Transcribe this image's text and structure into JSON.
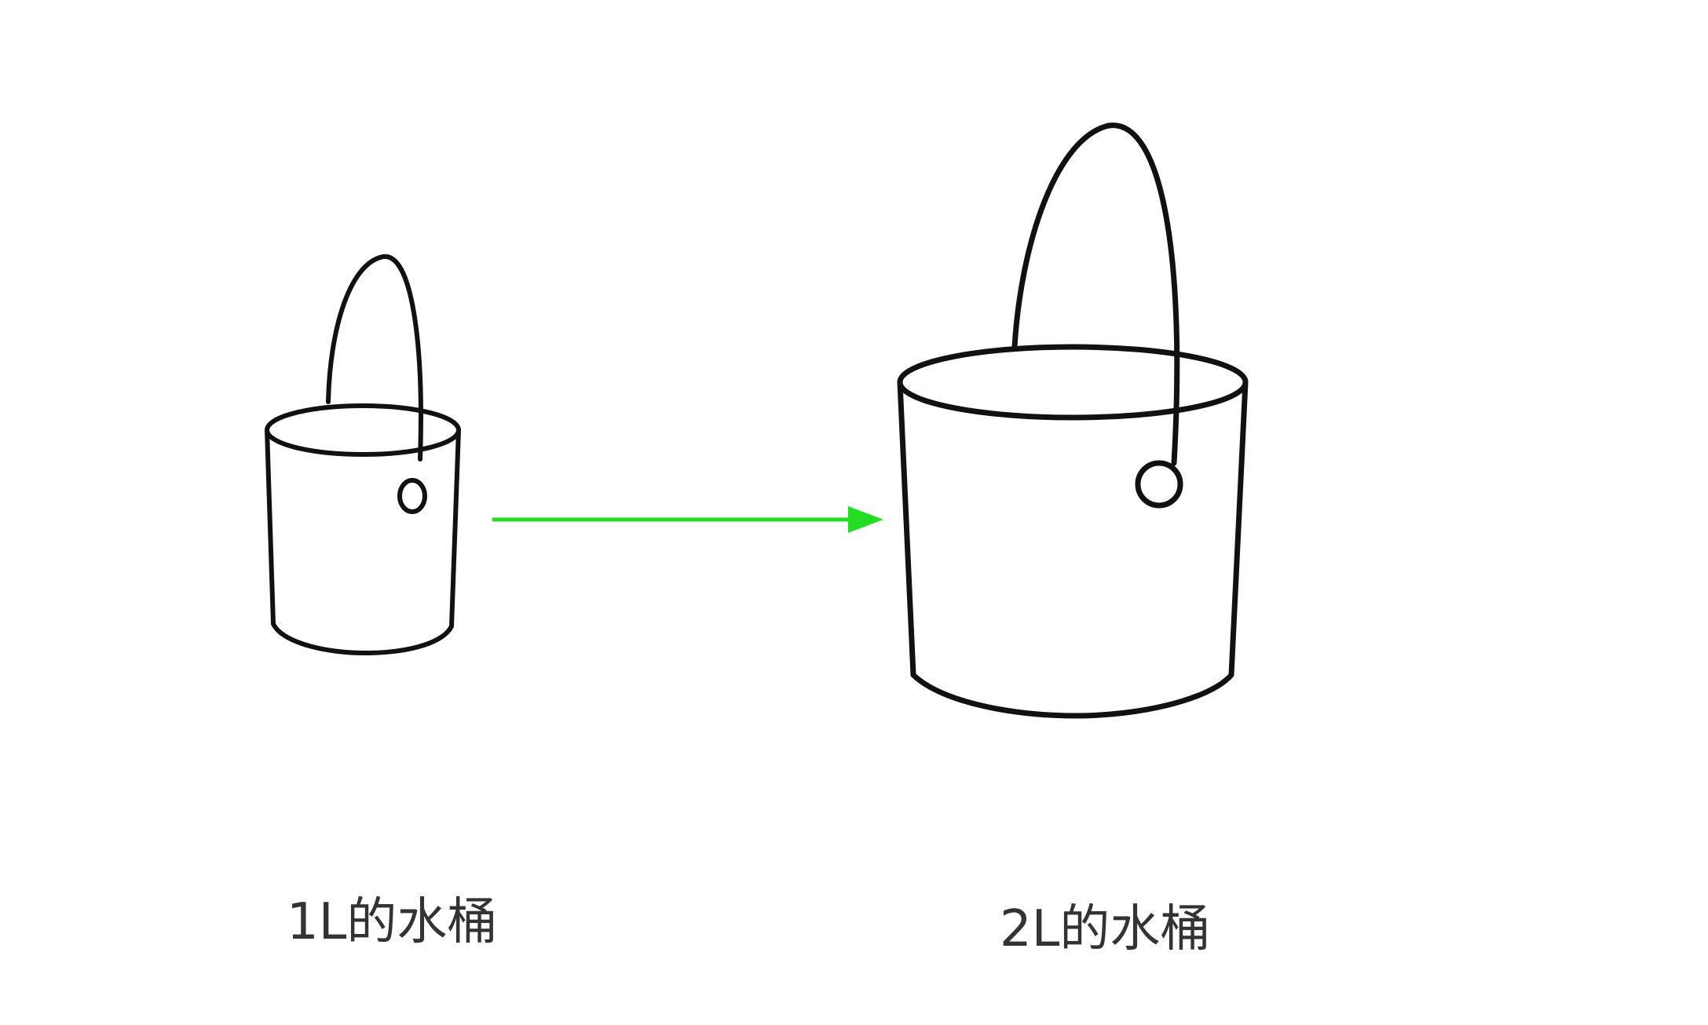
{
  "diagram": {
    "colors": {
      "stroke": "#111111",
      "arrow": "#22dd22",
      "text": "#333333",
      "background": "#ffffff"
    },
    "small_bucket": {
      "icon": "bucket-icon",
      "label": "1L的水桶"
    },
    "large_bucket": {
      "icon": "bucket-icon",
      "label": "2L的水桶"
    },
    "arrow": {
      "icon": "arrow-right-icon",
      "direction": "right"
    }
  }
}
